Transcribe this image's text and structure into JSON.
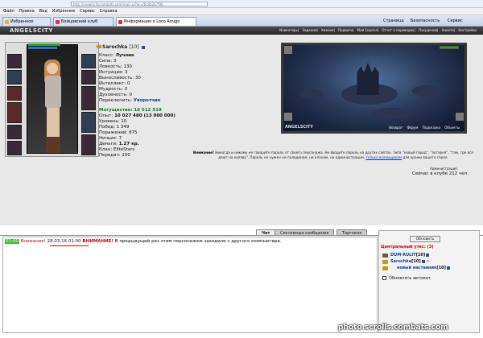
{
  "browser": {
    "address": "http://angelscity.combats.com/main.pl?ar=f6c8b2b7f9b",
    "menu": [
      "Файл",
      "Правка",
      "Вид",
      "Избранное",
      "Сервис",
      "Справка"
    ],
    "tabs": [
      "Избранное",
      "Бойцовский клуб",
      "Информация о Loco Amigo"
    ],
    "toolbar": [
      "Страница",
      "Безопасность",
      "Сервис"
    ]
  },
  "game": {
    "logo": "ANGELSCITY",
    "nav": [
      "Инвентарь",
      "Задания",
      "Умения",
      "Подвиги",
      "Мой Скролл",
      "Отчет о переводах",
      "Похудения",
      "Анкета",
      "Настройки"
    ]
  },
  "character": {
    "name": "Sarochka",
    "level": "[10]",
    "stats": [
      {
        "label": "Класс:",
        "value": "Лучник"
      },
      {
        "label": "Сила:",
        "value": "3"
      },
      {
        "label": "Ловкость:",
        "value": "130"
      },
      {
        "label": "Интуиция:",
        "value": "3"
      },
      {
        "label": "Выносливость:",
        "value": "30"
      },
      {
        "label": "Интеллект:",
        "value": "0"
      },
      {
        "label": "Мудрость:",
        "value": "0"
      },
      {
        "label": "Духовность:",
        "value": "0"
      },
      {
        "label": "Переключить:",
        "value": "Уворотчик"
      }
    ],
    "power": "Могущество: 10 512 519",
    "progress": [
      {
        "label": "Опыт:",
        "value": "10 027 480 (13 000 000)"
      },
      {
        "label": "Уровень:",
        "value": "10"
      },
      {
        "label": "Побед:",
        "value": "1 349"
      },
      {
        "label": "Поражений:",
        "value": "875"
      },
      {
        "label": "Ничьих:",
        "value": "7"
      },
      {
        "label": "Деньги:",
        "value": "1.27 кр."
      },
      {
        "label": "Клан:",
        "value": "EliteStars"
      },
      {
        "label": "Передач:",
        "value": "200"
      }
    ]
  },
  "scene": {
    "logo": "ANGELSCITY",
    "menu": [
      "Возврат",
      "Форум",
      "Подсказка",
      "Объекты"
    ]
  },
  "notice": {
    "bold": "Внимание!",
    "text": "Никогда и никому не говорите пароль от своего персонажа. Не вводите пароль на других сайтах, типа \"новый город\", \"лотерея\", \"там, где все дают на халяву\". Пароль не нужен ни паладинам, ни кланам, ни администрации,",
    "link": "только взломщикам",
    "tail": "для кражи вашего героя.",
    "admin": "Администрация.",
    "online": "Сейчас в клубе 212 чел."
  },
  "chat": {
    "tabs": [
      "Чат",
      "Системные сообщения",
      "Торговля"
    ],
    "time": "01:00",
    "prefix": "Внимание!",
    "datetime": "28.03.16 01:00",
    "alert": "ВНИМАНИЕ!",
    "message": "В предыдущий раз этим персонажем заходили с другого компьютера."
  },
  "room": {
    "refresh": "Обновить",
    "title": "Центральный утес: (3)",
    "users": [
      {
        "name": "DUM-RULIT",
        "level": "[10]"
      },
      {
        "name": "Sarochka",
        "level": "[10]"
      },
      {
        "name": "новый наставник",
        "level": "[10]"
      }
    ],
    "auto_refresh": "Обновлять автомат."
  },
  "watermark": "photo.scrolls.combats.com"
}
